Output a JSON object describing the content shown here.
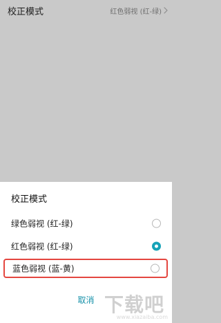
{
  "background_setting": {
    "label": "校正模式",
    "value": "红色弱视 (红-绿)",
    "icon": "chevron-right-icon"
  },
  "dialog": {
    "title": "校正模式",
    "options": [
      {
        "label": "绿色弱视 (红-绿)",
        "selected": false
      },
      {
        "label": "红色弱视 (红-绿)",
        "selected": true
      },
      {
        "label": "蓝色弱视 (蓝-黄)",
        "selected": false,
        "highlighted": true
      }
    ],
    "cancel_label": "取消"
  },
  "watermark": {
    "brand": "下载吧",
    "url": "www.xiazaiba.com"
  },
  "colors": {
    "accent": "#16a3b8",
    "cancel": "#1691a9",
    "highlight": "#e4463f",
    "scrim": "#c9c9c9"
  }
}
